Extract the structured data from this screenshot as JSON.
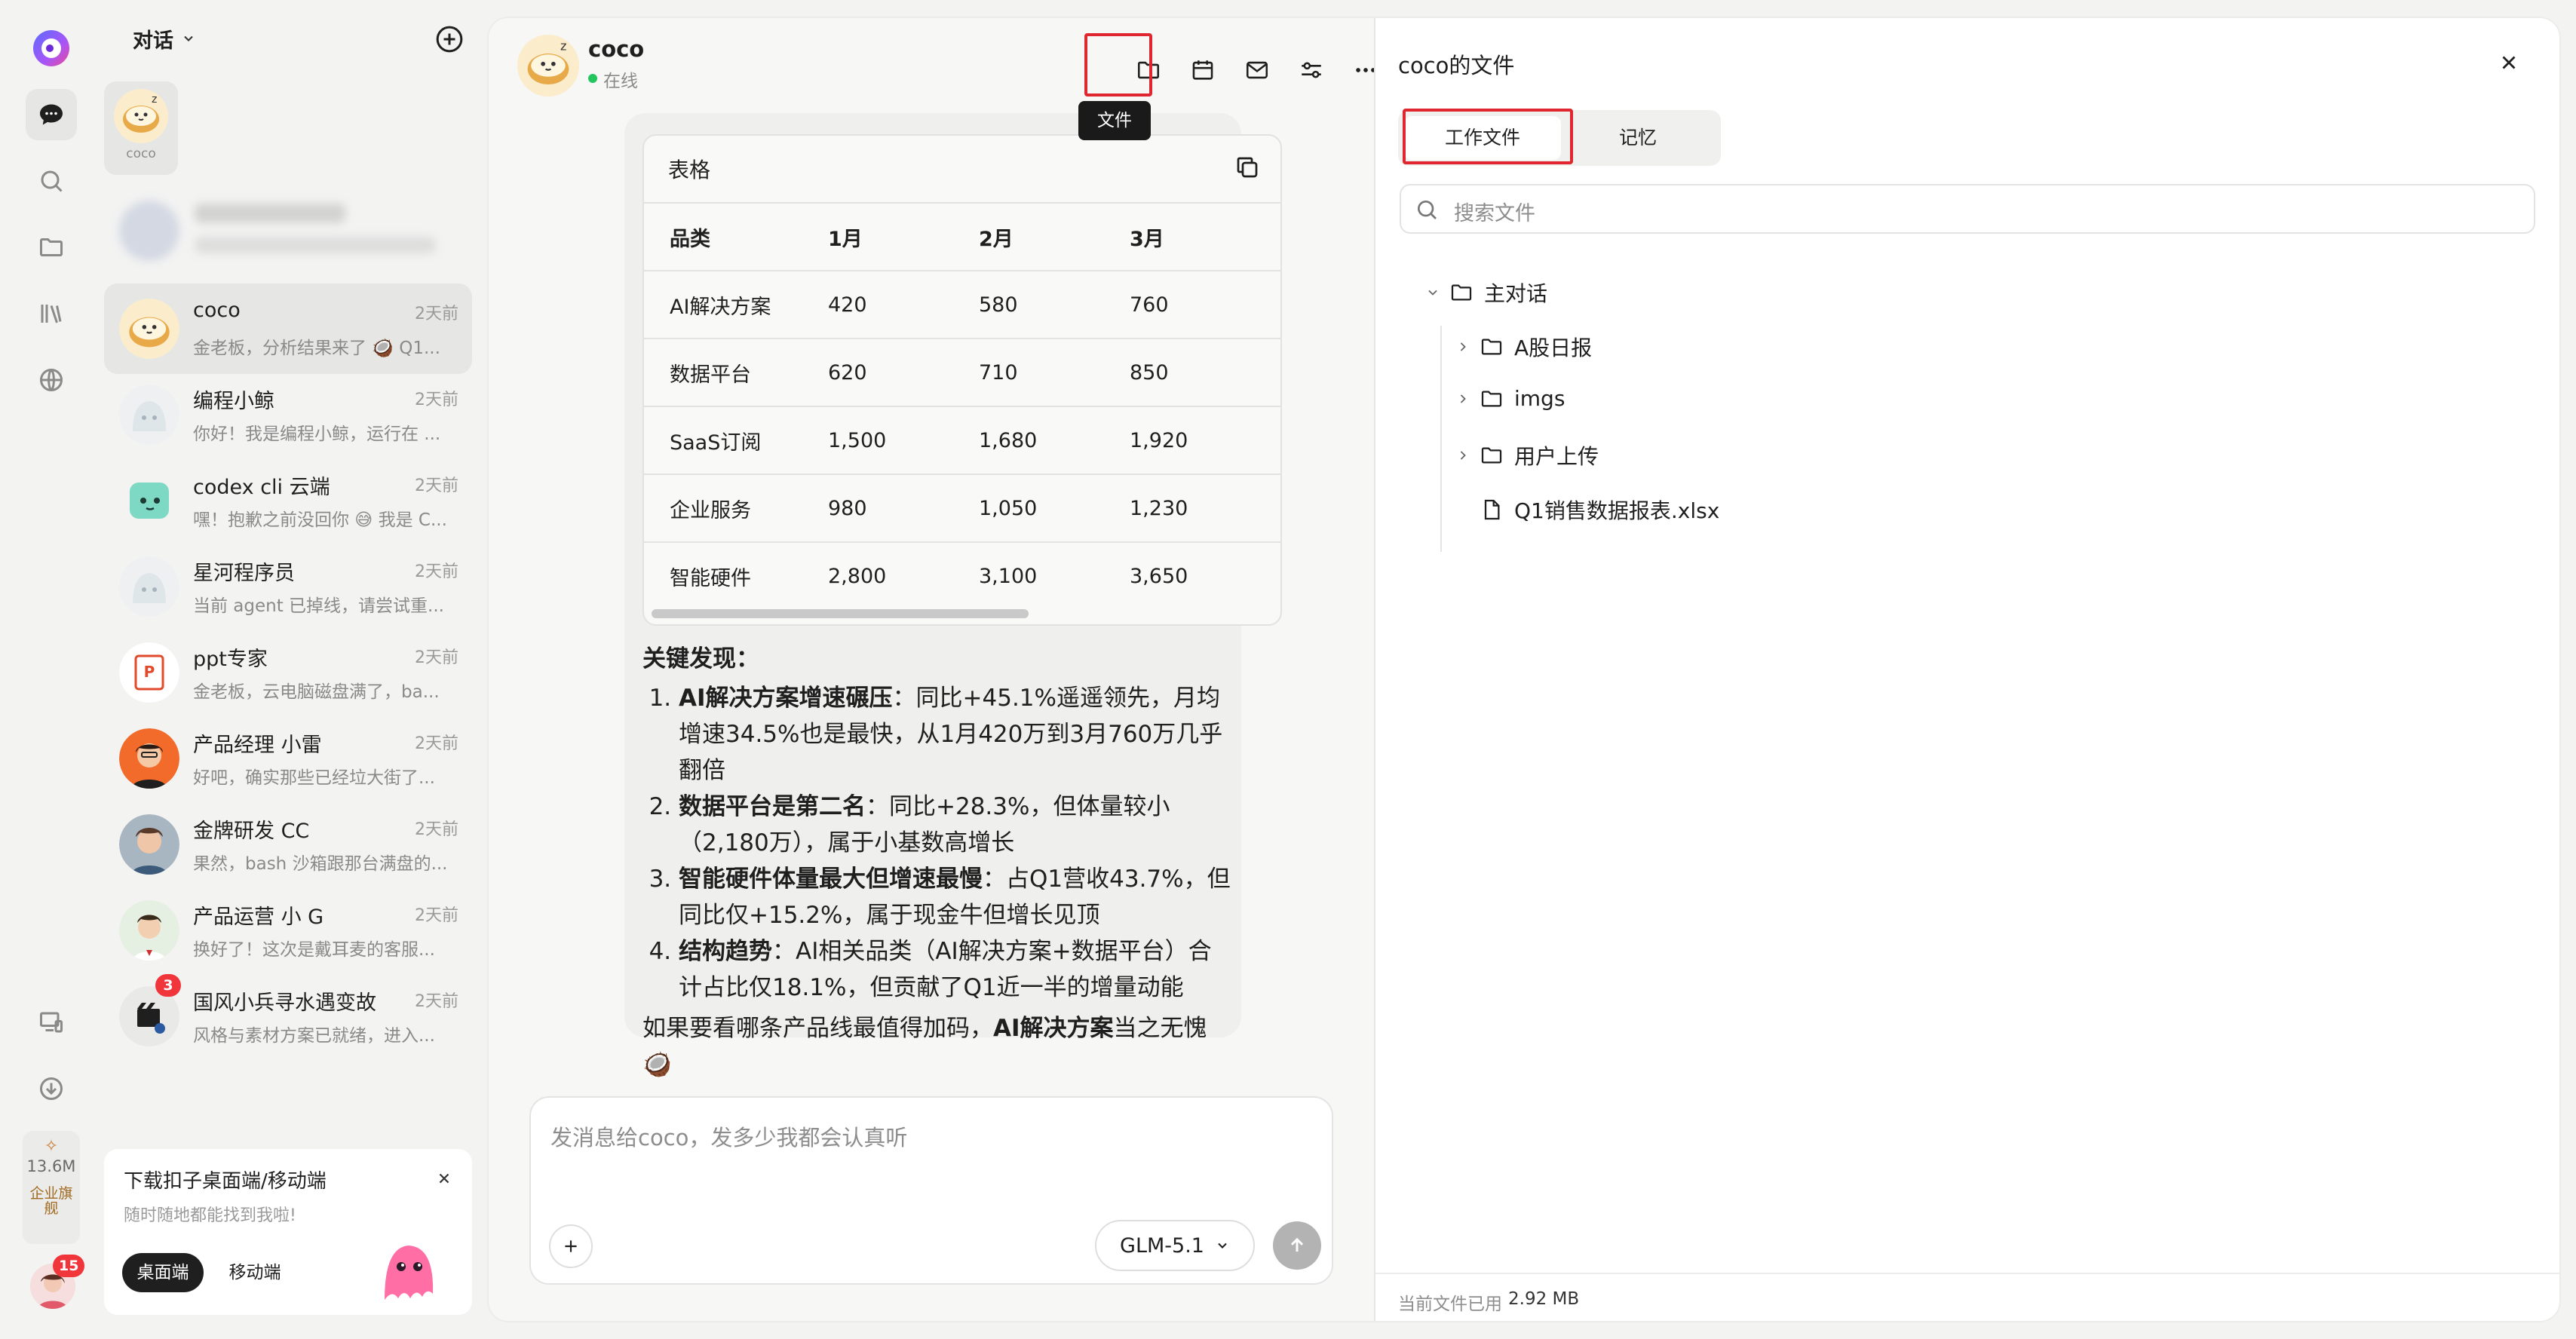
{
  "rail": {
    "storage": "13.6M",
    "enterprise": "企业旗舰",
    "avatar_badge": "15"
  },
  "sidebar": {
    "title": "对话",
    "pinned_label": "coco",
    "items": [
      {
        "name": "coco",
        "time": "2天前",
        "preview": "金老板，分析结果来了 🥥 Q1..."
      },
      {
        "name": "编程小鲸",
        "time": "2天前",
        "preview": "你好！我是编程小鲸，运行在 ..."
      },
      {
        "name": "codex cli 云端",
        "time": "2天前",
        "preview": "嘿！抱歉之前没回你 😅 我是 C..."
      },
      {
        "name": "星河程序员",
        "time": "2天前",
        "preview": "当前 agent 已掉线，请尝试重..."
      },
      {
        "name": "ppt专家",
        "time": "2天前",
        "preview": "金老板，云电脑磁盘满了，ba..."
      },
      {
        "name": "产品经理 小雷",
        "time": "2天前",
        "preview": "好吧，确实那些已经垃大街了..."
      },
      {
        "name": "金牌研发 CC",
        "time": "2天前",
        "preview": "果然，bash 沙箱跟那台满盘的..."
      },
      {
        "name": "产品运营 小 G",
        "time": "2天前",
        "preview": "换好了！这次是戴耳麦的客服..."
      },
      {
        "name": "国风小兵寻水遇变故",
        "time": "2天前",
        "preview": "风格与素材方案已就绪，进入...",
        "badge": "3"
      }
    ]
  },
  "promo": {
    "title": "下载扣子桌面端/移动端",
    "subtitle": "随时随地都能找到我啦!",
    "desktop": "桌面端",
    "mobile": "移动端"
  },
  "chat": {
    "name": "coco",
    "status": "在线",
    "tooltip": "文件",
    "table": {
      "title": "表格",
      "headers": [
        "品类",
        "1月",
        "2月",
        "3月"
      ],
      "rows": [
        [
          "AI解决方案",
          "420",
          "580",
          "760"
        ],
        [
          "数据平台",
          "620",
          "710",
          "850"
        ],
        [
          "SaaS订阅",
          "1,500",
          "1,680",
          "1,920"
        ],
        [
          "企业服务",
          "980",
          "1,050",
          "1,230"
        ],
        [
          "智能硬件",
          "2,800",
          "3,100",
          "3,650"
        ]
      ]
    },
    "findings_title": "关键发现：",
    "findings": [
      {
        "bold": "AI解决方案增速碾压",
        "text": "：同比+45.1%遥遥领先，月均增速34.5%也是最快，从1月420万到3月760万几乎翻倍"
      },
      {
        "bold": "数据平台是第二名",
        "text": "：同比+28.3%，但体量较小（2,180万），属于小基数高增长"
      },
      {
        "bold": "智能硬件体量最大但增速最慢",
        "text": "：占Q1营收43.7%，但同比仅+15.2%，属于现金牛但增长见顶"
      },
      {
        "bold": "结构趋势",
        "text": "：AI相关品类（AI解决方案+数据平台）合计占比仅18.1%，但贡献了Q1近一半的增量动能"
      }
    ],
    "closing_pre": "如果要看哪条产品线最值得加码，",
    "closing_bold": "AI解决方案",
    "closing_post": "当之无愧 🥥",
    "composer_placeholder": "发消息给coco，发多少我都会认真听",
    "model": "GLM-5.1"
  },
  "files": {
    "title": "coco的文件",
    "tabs": [
      "工作文件",
      "记忆"
    ],
    "search_placeholder": "搜索文件",
    "tree": [
      {
        "label": "主对话",
        "type": "folder",
        "level": 0,
        "expanded": true
      },
      {
        "label": "A股日报",
        "type": "folder",
        "level": 1
      },
      {
        "label": "imgs",
        "type": "folder",
        "level": 1
      },
      {
        "label": "用户上传",
        "type": "folder",
        "level": 1
      },
      {
        "label": "Q1销售数据报表.xlsx",
        "type": "file",
        "level": 1
      }
    ],
    "footer_label": "当前文件已用",
    "footer_size": "2.92 MB"
  },
  "colors": {
    "accent_red": "#e0262f",
    "online": "#22c55e",
    "badge": "#f0353b"
  }
}
